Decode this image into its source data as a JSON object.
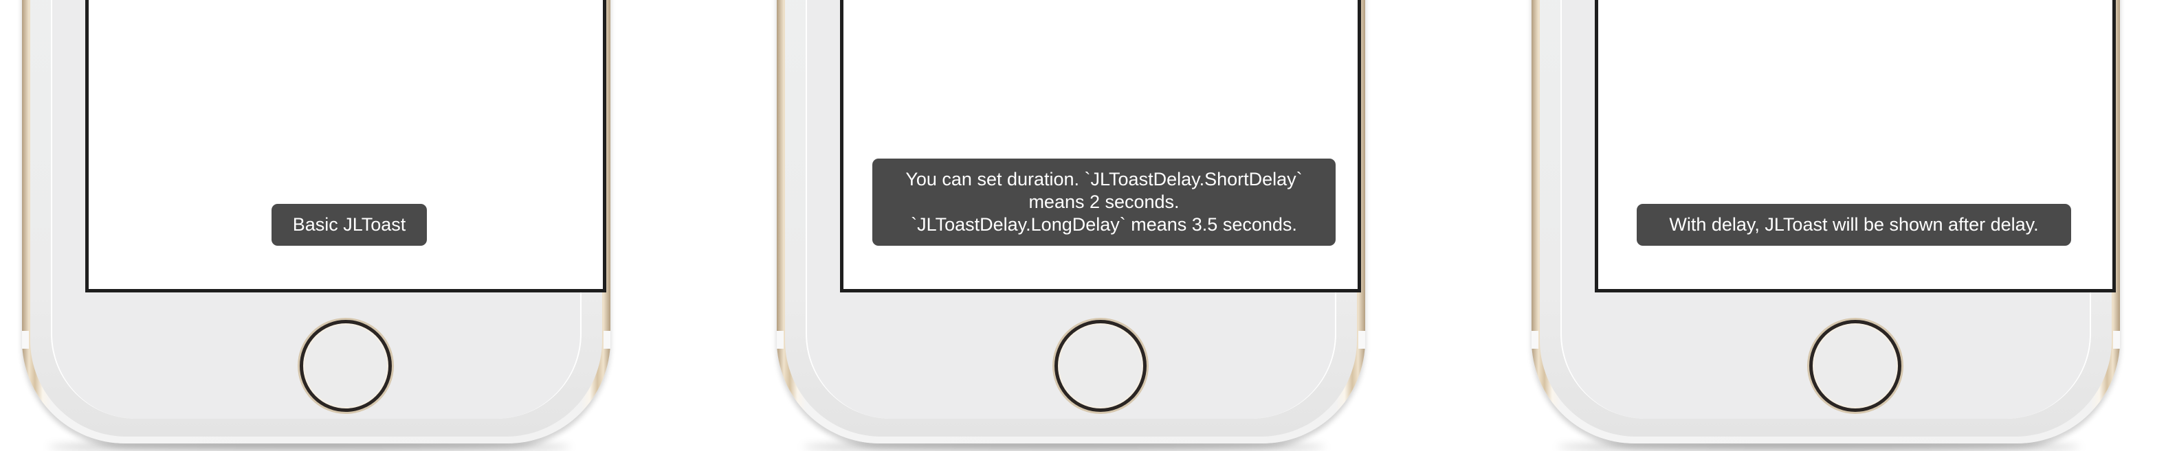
{
  "screenshots": [
    {
      "toast_text": "Basic JLToast"
    },
    {
      "toast_text": "You can set duration. `JLToastDelay.ShortDelay`\nmeans 2 seconds.\n`JLToastDelay.LongDelay` means 3.5 seconds."
    },
    {
      "toast_text": "With delay, JLToast will be shown after delay."
    }
  ],
  "colors": {
    "toast_background": "#4a4a4a",
    "toast_text": "#ffffff",
    "screen_background": "#ffffff",
    "device_body": "#ececec",
    "device_frame_gold": "#d7c3a3"
  },
  "icons": {
    "home_button": "home-button-icon"
  }
}
